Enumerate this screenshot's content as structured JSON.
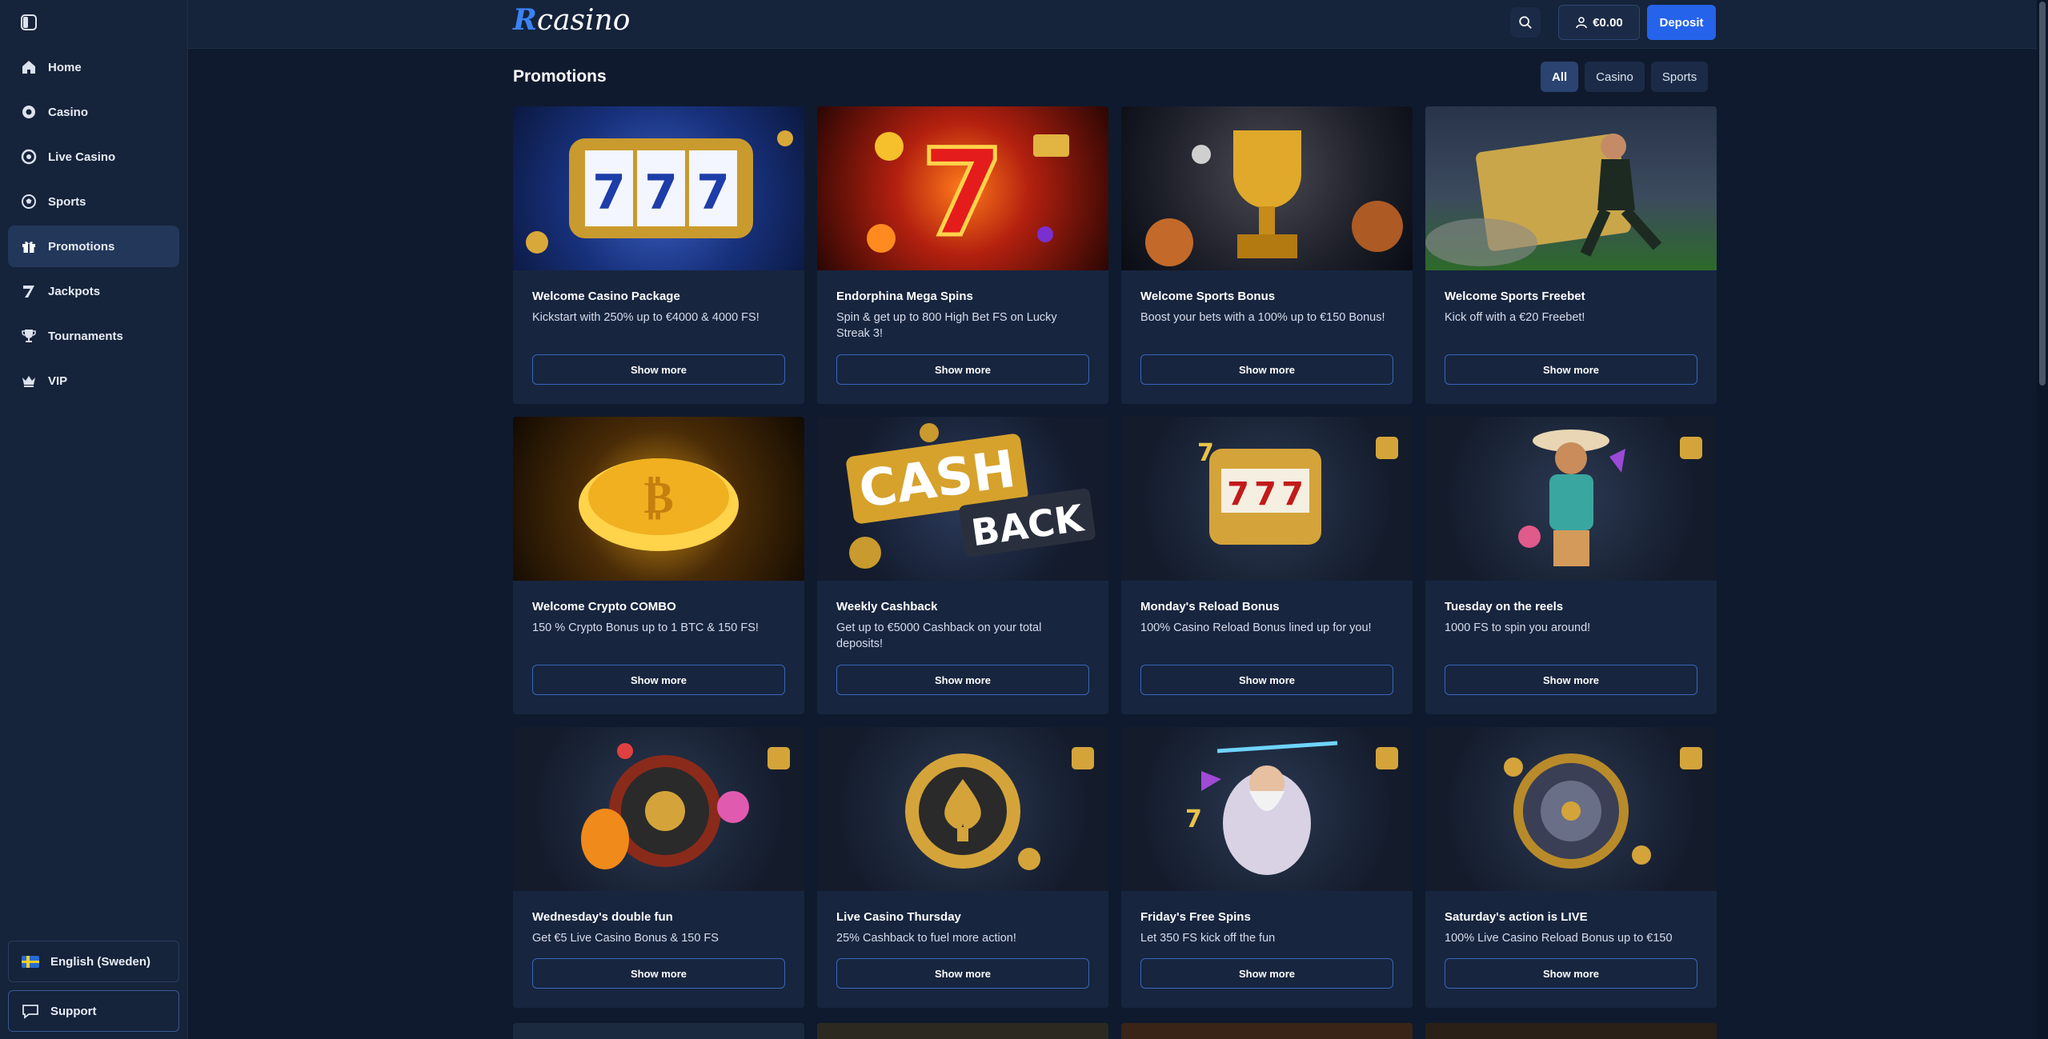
{
  "brand": {
    "logo_r": "R",
    "logo_text": "casino",
    "accent": "#2563eb"
  },
  "sidebar": {
    "items": [
      {
        "label": "Home",
        "icon": "home-icon"
      },
      {
        "label": "Casino",
        "icon": "casino-chip-icon"
      },
      {
        "label": "Live Casino",
        "icon": "live-casino-icon"
      },
      {
        "label": "Sports",
        "icon": "soccer-ball-icon"
      },
      {
        "label": "Promotions",
        "icon": "gift-icon",
        "active": true
      },
      {
        "label": "Jackpots",
        "icon": "seven-icon"
      },
      {
        "label": "Tournaments",
        "icon": "trophy-icon"
      },
      {
        "label": "VIP",
        "icon": "crown-icon"
      }
    ],
    "language": "English (Sweden)",
    "support": "Support"
  },
  "header": {
    "balance": "€0.00",
    "deposit": "Deposit"
  },
  "main": {
    "title": "Promotions",
    "filters": [
      "All",
      "Casino",
      "Sports"
    ],
    "cards": [
      {
        "title": "Welcome Casino Package",
        "desc": "Kickstart with 250% up to €4000 & 4000 FS!",
        "button": "Show more"
      },
      {
        "title": "Endorphina Mega Spins",
        "desc": "Spin & get up to 800 High Bet FS on Lucky Streak 3!",
        "button": "Show more"
      },
      {
        "title": "Welcome Sports Bonus",
        "desc": "Boost your bets with a 100% up to €150 Bonus!",
        "button": "Show more"
      },
      {
        "title": "Welcome Sports Freebet",
        "desc": "Kick off with a €20 Freebet!",
        "button": "Show more"
      },
      {
        "title": "Welcome Crypto COMBO",
        "desc": "150 % Crypto Bonus up to 1 BTC & 150 FS!",
        "button": "Show more"
      },
      {
        "title": "Weekly Cashback",
        "desc": "Get up to €5000 Cashback on your total deposits!",
        "button": "Show more",
        "img_text_1": "CASH",
        "img_text_2": "BACK"
      },
      {
        "title": "Monday's Reload Bonus",
        "desc": "100% Casino Reload Bonus lined up for you!",
        "button": "Show more"
      },
      {
        "title": "Tuesday on the reels",
        "desc": "1000 FS to spin you around!",
        "button": "Show more"
      },
      {
        "title": "Wednesday's double fun",
        "desc": "Get €5 Live Casino Bonus & 150 FS",
        "button": "Show more"
      },
      {
        "title": "Live Casino Thursday",
        "desc": "25% Cashback to fuel more action!",
        "button": "Show more"
      },
      {
        "title": "Friday's Free Spins",
        "desc": "Let 350 FS kick off the fun",
        "button": "Show more"
      },
      {
        "title": "Saturday's action is LIVE",
        "desc": "100% Live Casino Reload Bonus up to €150",
        "button": "Show more"
      }
    ]
  }
}
